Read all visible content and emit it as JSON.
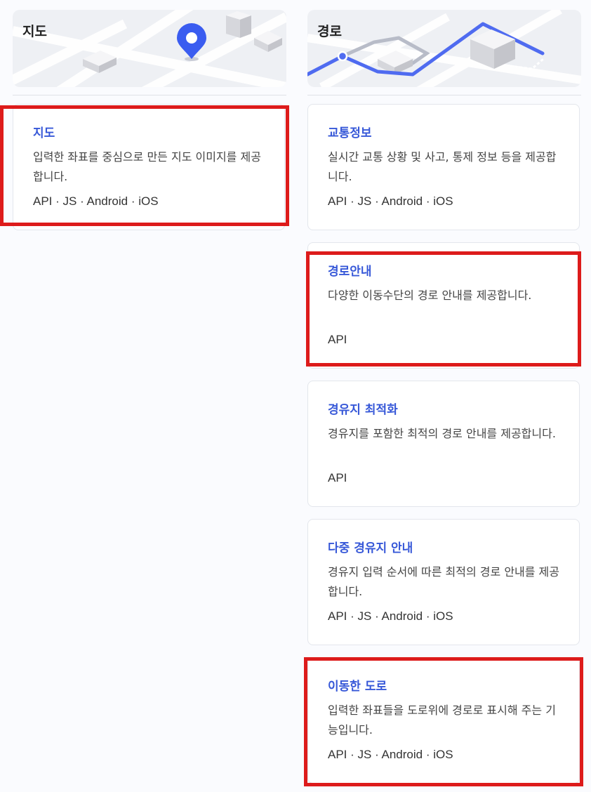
{
  "sections": {
    "map": {
      "title": "지도",
      "cards": [
        {
          "title": "지도",
          "desc": "입력한 좌표를 중심으로 만든 지도 이미지를 제공합니다.",
          "platforms": "API · JS · Android · iOS"
        }
      ]
    },
    "route": {
      "title": "경로",
      "cards": [
        {
          "title": "교통정보",
          "desc": "실시간 교통 상황 및 사고, 통제 정보 등을 제공합니다.",
          "platforms": "API · JS · Android · iOS"
        },
        {
          "title": "경로안내",
          "desc": "다양한 이동수단의 경로 안내를 제공합니다.",
          "platforms": "API"
        },
        {
          "title": "경유지 최적화",
          "desc": "경유지를 포함한 최적의 경로 안내를 제공합니다.",
          "platforms": "API"
        },
        {
          "title": "다중 경유지 안내",
          "desc": "경유지 입력 순서에 따른 최적의 경로 안내를 제공합니다.",
          "platforms": "API · JS · Android · iOS"
        },
        {
          "title": "이동한 도로",
          "desc": "입력한 좌표들을 도로위에 경로로 표시해 주는 기능입니다.",
          "platforms": "API · JS · Android · iOS"
        }
      ]
    }
  },
  "colors": {
    "title_accent": "#3758d8",
    "highlight": "#dd1b1b",
    "route_line": "#4f6bf0",
    "pin": "#3a5cf0"
  },
  "icons": [
    "map-pin-icon",
    "building-icon",
    "route-line-icon"
  ]
}
